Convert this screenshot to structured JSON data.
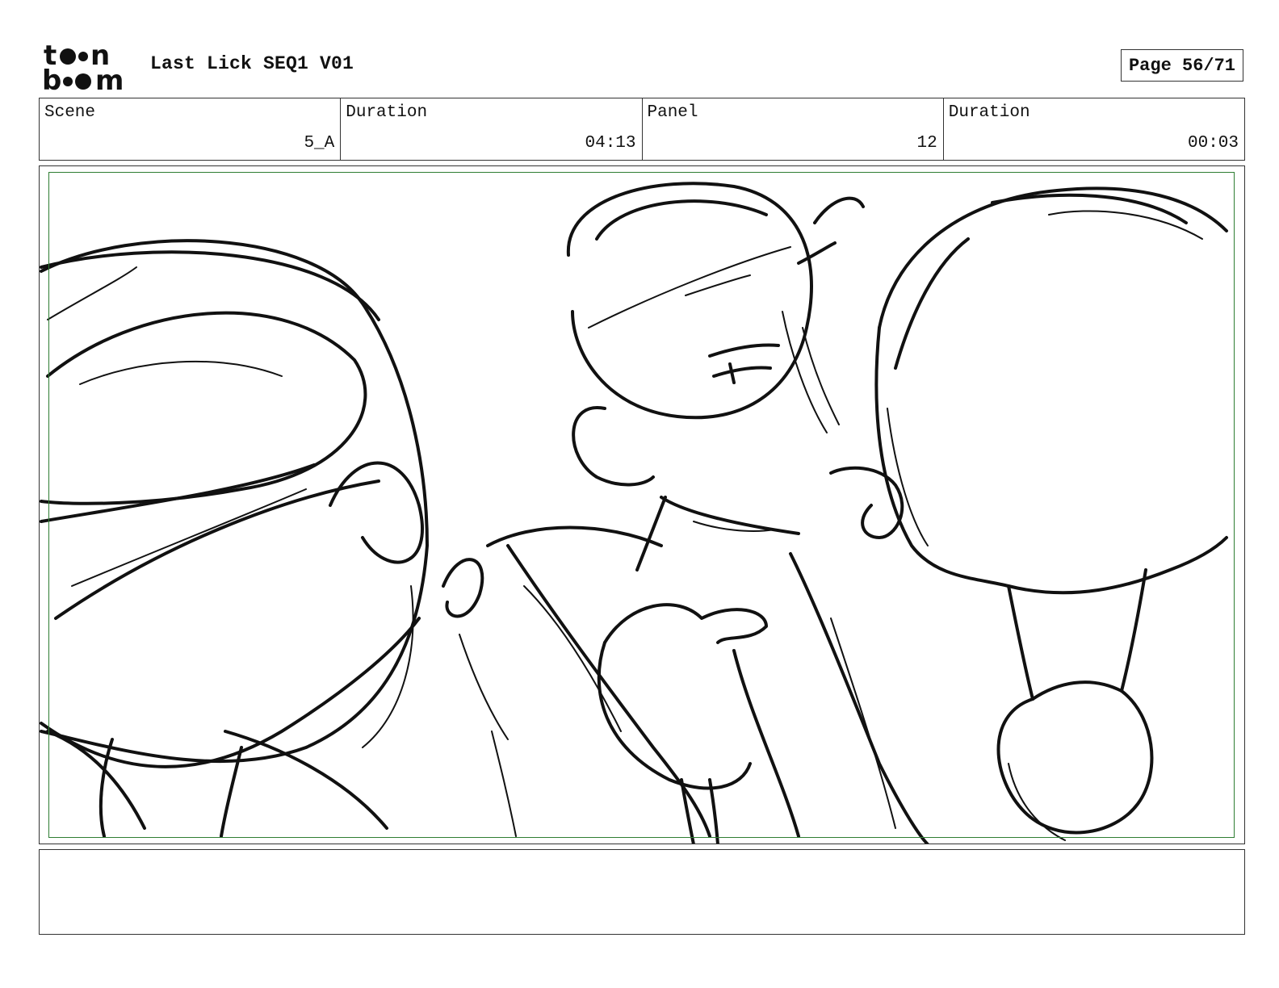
{
  "header": {
    "logo_text": "toon boom",
    "title": "Last Lick SEQ1 V01",
    "page": "Page 56/71"
  },
  "info": {
    "scene_label": "Scene",
    "scene_value": "5_A",
    "scene_duration_label": "Duration",
    "scene_duration_value": "04:13",
    "panel_label": "Panel",
    "panel_value": "12",
    "panel_duration_label": "Duration",
    "panel_duration_value": "00:03"
  },
  "panel": {
    "image_content": "rough storyboard sketch",
    "safe_frame_color": "#2e7d32"
  },
  "notes": {
    "text": ""
  }
}
